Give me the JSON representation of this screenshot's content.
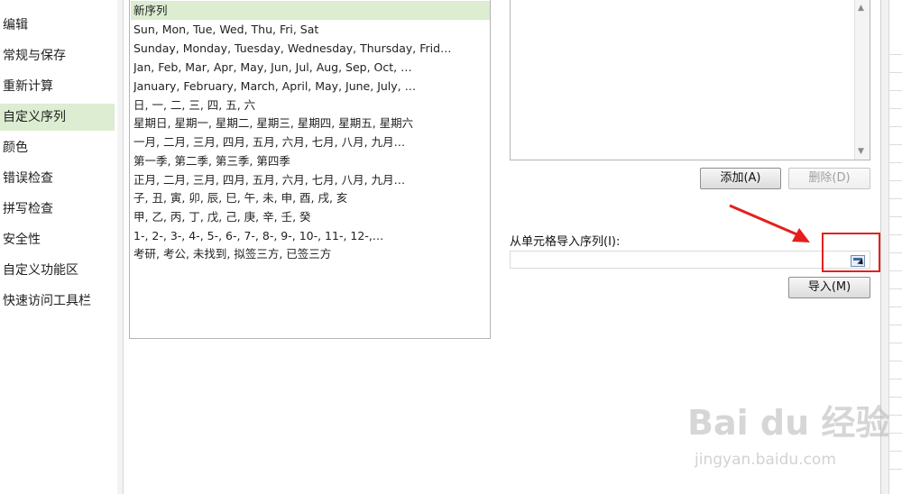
{
  "nav": {
    "items": [
      {
        "label": "编辑"
      },
      {
        "label": "常规与保存"
      },
      {
        "label": "重新计算"
      },
      {
        "label": "自定义序列",
        "selected": true
      },
      {
        "label": "颜色"
      },
      {
        "label": "错误检查"
      },
      {
        "label": "拼写检查"
      },
      {
        "label": "安全性"
      },
      {
        "label": "自定义功能区"
      },
      {
        "label": "快速访问工具栏"
      }
    ]
  },
  "sequences": {
    "items": [
      "新序列",
      "Sun, Mon, Tue, Wed, Thu, Fri, Sat",
      "Sunday, Monday, Tuesday, Wednesday, Thursday, Frid…",
      "Jan, Feb, Mar, Apr, May, Jun, Jul, Aug, Sep, Oct, …",
      "January, February, March, April, May, June, July, …",
      "日, 一, 二, 三, 四, 五, 六",
      "星期日, 星期一, 星期二, 星期三, 星期四, 星期五, 星期六",
      "一月, 二月, 三月, 四月, 五月, 六月, 七月, 八月, 九月…",
      "第一季, 第二季, 第三季, 第四季",
      "正月, 二月, 三月, 四月, 五月, 六月, 七月, 八月, 九月…",
      "子, 丑, 寅, 卯, 辰, 巳, 午, 未, 申, 酉, 戌, 亥",
      "甲, 乙, 丙, 丁, 戊, 己, 庚, 辛, 壬, 癸",
      "1-, 2-, 3-, 4-, 5-, 6-, 7-, 8-, 9-, 10-, 11-, 12-,…",
      "考研, 考公, 未找到, 拟签三方, 已签三方"
    ]
  },
  "buttons": {
    "add": "添加(A)",
    "delete": "删除(D)",
    "import": "导入(M)"
  },
  "import_label": "从单元格导入序列(I):",
  "import_value": "",
  "watermark": {
    "logo": "Bai du 经验",
    "url": "jingyan.baidu.com"
  },
  "colors": {
    "selection": "#dcedd2",
    "arrow": "#e4201d"
  }
}
